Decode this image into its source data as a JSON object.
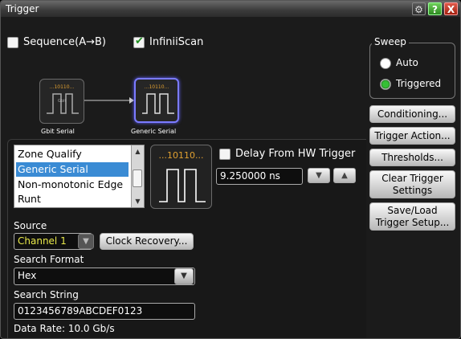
{
  "window": {
    "title": "Trigger"
  },
  "titlebar": {
    "help_label": "?",
    "close_label": "X"
  },
  "top": {
    "sequence_label": "Sequence(A→B)",
    "sequence_checked": false,
    "infiniiscan_label": "InfiniiScan",
    "infiniiscan_checked": true
  },
  "diagram": {
    "block_a": {
      "bits": "...10110...",
      "inner": "Gbit",
      "caption": "Gbit Serial"
    },
    "block_b": {
      "bits": "...10110...",
      "caption": "Generic Serial"
    }
  },
  "mode_list": {
    "items": [
      "Zone Qualify",
      "Generic Serial",
      "Non-monotonic Edge",
      "Runt"
    ],
    "selected": "Generic Serial"
  },
  "preview": {
    "bits": "...10110..."
  },
  "delay": {
    "label": "Delay From HW Trigger",
    "checked": false,
    "value": "9.250000 ns"
  },
  "source": {
    "label": "Source",
    "value": "Channel 1",
    "clock_recovery_label": "Clock Recovery..."
  },
  "search_format": {
    "label": "Search Format",
    "value": "Hex"
  },
  "search_string": {
    "label": "Search String",
    "value": "0123456789ABCDEF0123"
  },
  "data_rate": "Data Rate: 10.0 Gb/s",
  "sweep": {
    "label": "Sweep",
    "options": [
      "Auto",
      "Triggered"
    ],
    "selected": "Triggered"
  },
  "right_buttons": {
    "conditioning": "Conditioning...",
    "trigger_action": "Trigger Action...",
    "thresholds": "Thresholds...",
    "clear_line1": "Clear Trigger",
    "clear_line2": "Settings",
    "saveload_line1": "Save/Load",
    "saveload_line2": "Trigger Setup..."
  },
  "colors": {
    "background": "#1b1b1b",
    "selection": "#3a8bd4",
    "channel1": "#e8e84a",
    "bits": "#e0a030",
    "radio_on": "#35c035"
  }
}
